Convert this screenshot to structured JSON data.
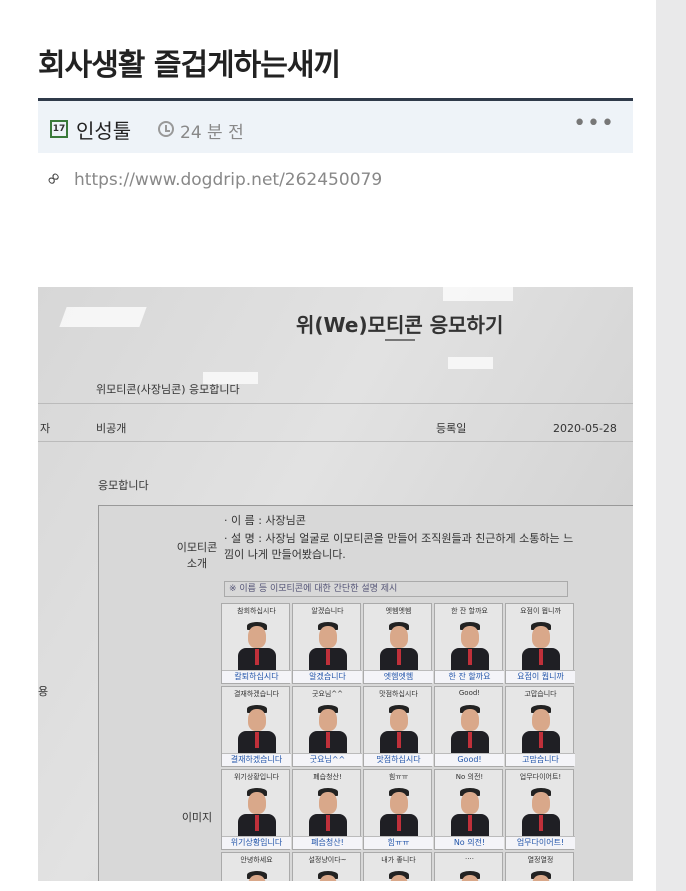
{
  "post": {
    "title": "회사생활 즐겁게하는새끼",
    "author": "인성툴",
    "time": "24 분 전",
    "more": "•••",
    "url": "https://www.dogdrip.net/262450079",
    "badge": "🄽"
  },
  "photo": {
    "heading": "위(We)모티콘 응모하기",
    "row1_label": "위모티콘(사장님콘) 응모합니다",
    "row2_left_label": "자",
    "row2_value": "비공개",
    "row2_date_label": "등록일",
    "row2_date": "2020-05-28",
    "row3_text": "응모합니다",
    "side_label_1": "용",
    "intro_label": "이모티콘\n소개",
    "intro_name": "· 이 름 : 사장님콘",
    "intro_desc": "· 설 명 : 사장님 얼굴로 이모티콘을 만들어 조직원들과 친근하게 소통하는 느낌이 나게 만들어봤습니다.",
    "intro_note": "※ 이름 등 이모티콘에 대한 간단한 설명 제시",
    "image_label": "이미지",
    "emoticons": [
      {
        "cap": "참회하십시다",
        "label": "칼퇴하십시다"
      },
      {
        "cap": "알겠습니다",
        "label": "알겠습니다"
      },
      {
        "cap": "엣헴엣헴",
        "label": "엣헴엣헴"
      },
      {
        "cap": "한 잔 할까요",
        "label": "한 잔 할까요"
      },
      {
        "cap": "요점이 뭡니까",
        "label": "요점이 뭡니까"
      },
      {
        "cap": "결재하겠습니다",
        "label": "결재하겠습니다"
      },
      {
        "cap": "굿요님^^",
        "label": "굿요님^^"
      },
      {
        "cap": "맛점하십시다",
        "label": "맛점하십시다"
      },
      {
        "cap": "Good!",
        "label": "Good!"
      },
      {
        "cap": "고맙습니다",
        "label": "고맙습니다"
      },
      {
        "cap": "위기상황입니다",
        "label": "위기상황입니다"
      },
      {
        "cap": "폐습청산!",
        "label": "폐습청산!"
      },
      {
        "cap": "힘ㅠㅠ",
        "label": "힘ㅠㅠ"
      },
      {
        "cap": "No 의전!",
        "label": "No 의전!"
      },
      {
        "cap": "업무다이어트!",
        "label": "업무다이어트!"
      },
      {
        "cap": "안녕하세요",
        "label": ""
      },
      {
        "cap": "설정냥이다~",
        "label": ""
      },
      {
        "cap": "내가 좋니다",
        "label": ""
      },
      {
        "cap": "····",
        "label": ""
      },
      {
        "cap": "열정열정",
        "label": ""
      }
    ]
  }
}
